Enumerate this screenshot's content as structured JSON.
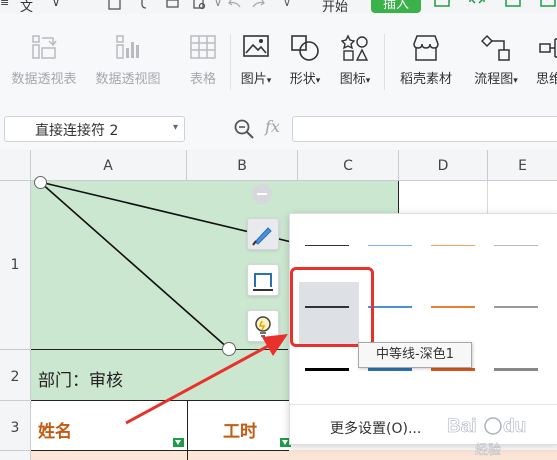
{
  "menubar": {
    "file_label": "文件",
    "tab_start": "开始",
    "tab_insert": "插入"
  },
  "ribbon": {
    "buttons": [
      {
        "label": "数据透视表",
        "enabled": false,
        "icon": "pivot-table-icon"
      },
      {
        "label": "数据透视图",
        "enabled": false,
        "icon": "pivot-chart-icon"
      },
      {
        "label": "表格",
        "enabled": false,
        "icon": "table-icon"
      },
      {
        "label": "图片",
        "enabled": true,
        "icon": "picture-icon",
        "has_dropdown": true
      },
      {
        "label": "形状",
        "enabled": true,
        "icon": "shapes-icon",
        "has_dropdown": true
      },
      {
        "label": "图标",
        "enabled": true,
        "icon": "icons-icon",
        "has_dropdown": true
      },
      {
        "label": "稻壳素材",
        "enabled": true,
        "icon": "docer-store-icon"
      },
      {
        "label": "流程图",
        "enabled": true,
        "icon": "flowchart-icon",
        "has_dropdown": true
      },
      {
        "label": "思维",
        "enabled": true,
        "icon": "mindmap-icon"
      }
    ]
  },
  "formula_bar": {
    "name_box_value": "直接连接符 2",
    "fx_label": "fx",
    "formula_value": ""
  },
  "columns": [
    "A",
    "B",
    "C",
    "D",
    "E"
  ],
  "rows": [
    "1",
    "2",
    "3"
  ],
  "cells": {
    "a2": "部门：审核",
    "a3": "姓名",
    "b3": "工时"
  },
  "line_popup": {
    "tooltip": "中等线-深色1",
    "more_settings": "更多设置(O)...",
    "rows": [
      {
        "colors": [
          "#333333",
          "#7fb2e0",
          "#f4a460",
          "#b8b8b8"
        ],
        "weight": "thin"
      },
      {
        "colors": [
          "#333333",
          "#4a90d9",
          "#ed7d31",
          "#999999"
        ],
        "weight": "medium",
        "selected_index": 0
      },
      {
        "colors": [
          "#000000",
          "#2e75b6",
          "#d9591c",
          "#888888"
        ],
        "weight": "thick"
      }
    ]
  },
  "floating_tools": [
    "line-style-icon",
    "outline-icon",
    "bulb-icon"
  ],
  "colors": {
    "accent_green": "#3bb14a",
    "cell_green": "#cce7d0",
    "orange_text": "#c55a11",
    "annotation_red": "#e8312b"
  },
  "watermark": "Baidu 经验"
}
